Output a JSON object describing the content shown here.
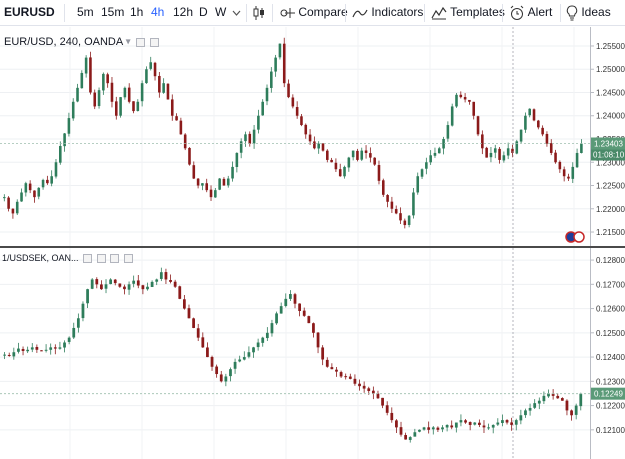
{
  "toolbar": {
    "symbol": "EURUSD",
    "timeframes": [
      "5m",
      "15m",
      "1h",
      "4h",
      "12h",
      "D",
      "W"
    ],
    "active_timeframe": "4h",
    "compare_label": "Compare",
    "indicators_label": "Indicators",
    "templates_label": "Templates",
    "alert_label": "Alert",
    "ideas_label": "Ideas"
  },
  "pane1": {
    "legend": "EUR/USD, 240, OANDA",
    "price_labels": [
      "1.25500",
      "1.25000",
      "1.24500",
      "1.24000",
      "1.23500",
      "1.23000",
      "1.22500",
      "1.22000",
      "1.21500"
    ],
    "last_price": "1.23403",
    "countdown": "01:08:10"
  },
  "pane2": {
    "legend": "1/USDSEK, OAN...",
    "price_labels": [
      "0.12800",
      "0.12700",
      "0.12600",
      "0.12500",
      "0.12400",
      "0.12300",
      "0.12200",
      "0.12100"
    ],
    "last_price": "0.12249"
  },
  "colors": {
    "up": "#2e7d5b",
    "down": "#8b1a1a",
    "last_price_bg": "#5b9a78",
    "countdown_bg": "#4a8a69",
    "accent": "#2962ff"
  },
  "chart_data": [
    {
      "type": "candlestick",
      "title": "EUR/USD, 240, OANDA",
      "ylim": [
        1.2135,
        1.2565
      ],
      "closes": [
        1.2225,
        1.22,
        1.219,
        1.2215,
        1.2235,
        1.2255,
        1.224,
        1.2225,
        1.2245,
        1.2262,
        1.2255,
        1.227,
        1.23,
        1.2335,
        1.2362,
        1.2395,
        1.243,
        1.246,
        1.2492,
        1.2525,
        1.245,
        1.242,
        1.2455,
        1.249,
        1.247,
        1.243,
        1.24,
        1.244,
        1.246,
        1.243,
        1.241,
        1.243,
        1.247,
        1.25,
        1.2515,
        1.2485,
        1.245,
        1.247,
        1.2435,
        1.24,
        1.239,
        1.236,
        1.233,
        1.2295,
        1.2265,
        1.225,
        1.2255,
        1.224,
        1.2225,
        1.224,
        1.2265,
        1.225,
        1.2265,
        1.229,
        1.232,
        1.2345,
        1.236,
        1.234,
        1.237,
        1.24,
        1.243,
        1.246,
        1.2495,
        1.2525,
        1.2555,
        1.247,
        1.244,
        1.242,
        1.24,
        1.238,
        1.236,
        1.2345,
        1.233,
        1.234,
        1.2325,
        1.2305,
        1.23,
        1.2285,
        1.227,
        1.229,
        1.231,
        1.2325,
        1.2305,
        1.2325,
        1.232,
        1.231,
        1.2295,
        1.226,
        1.223,
        1.2215,
        1.22,
        1.219,
        1.2175,
        1.2165,
        1.2185,
        1.2235,
        1.227,
        1.2285,
        1.23,
        1.2315,
        1.232,
        1.233,
        1.235,
        1.238,
        1.242,
        1.2445,
        1.244,
        1.2435,
        1.243,
        1.24,
        1.236,
        1.233,
        1.231,
        1.232,
        1.233,
        1.2305,
        1.2315,
        1.233,
        1.232,
        1.2345,
        1.237,
        1.24,
        1.2415,
        1.239,
        1.2375,
        1.236,
        1.234,
        1.232,
        1.23,
        1.2285,
        1.227,
        1.2265,
        1.229,
        1.232,
        1.234
      ]
    },
    {
      "type": "candlestick",
      "title": "1/USDSEK, OAN...",
      "ylim": [
        0.12025,
        0.12825
      ],
      "closes": [
        0.1241,
        0.12405,
        0.1242,
        0.12435,
        0.12425,
        0.1243,
        0.1244,
        0.1243,
        0.12425,
        0.1243,
        0.1244,
        0.12435,
        0.1244,
        0.1246,
        0.1248,
        0.1252,
        0.1256,
        0.1262,
        0.1268,
        0.1272,
        0.127,
        0.1268,
        0.127,
        0.1272,
        0.12705,
        0.1269,
        0.1268,
        0.127,
        0.12715,
        0.12695,
        0.1268,
        0.1269,
        0.1271,
        0.1272,
        0.1275,
        0.1272,
        0.1271,
        0.1269,
        0.1264,
        0.126,
        0.1256,
        0.1252,
        0.1248,
        0.1244,
        0.124,
        0.1236,
        0.1233,
        0.123,
        0.1232,
        0.1235,
        0.1238,
        0.1239,
        0.124,
        0.1242,
        0.1244,
        0.1246,
        0.1248,
        0.125,
        0.1254,
        0.1258,
        0.1261,
        0.1264,
        0.1266,
        0.1262,
        0.1259,
        0.1257,
        0.1254,
        0.125,
        0.1244,
        0.1239,
        0.1236,
        0.1235,
        0.1234,
        0.1232,
        0.1232,
        0.1231,
        0.1229,
        0.1228,
        0.1227,
        0.1226,
        0.1225,
        0.1223,
        0.122,
        0.1217,
        0.1214,
        0.1211,
        0.1208,
        0.1206,
        0.1207,
        0.1209,
        0.121,
        0.1211,
        0.121,
        0.1211,
        0.121,
        0.1211,
        0.1212,
        0.1211,
        0.1213,
        0.1214,
        0.1213,
        0.1212,
        0.1213,
        0.1212,
        0.1211,
        0.1211,
        0.1212,
        0.1213,
        0.1214,
        0.1213,
        0.1212,
        0.1214,
        0.1216,
        0.1218,
        0.1219,
        0.1221,
        0.1222,
        0.1224,
        0.1225,
        0.1224,
        0.1223,
        0.1222,
        0.1218,
        0.1216,
        0.122,
        0.12249
      ]
    }
  ]
}
